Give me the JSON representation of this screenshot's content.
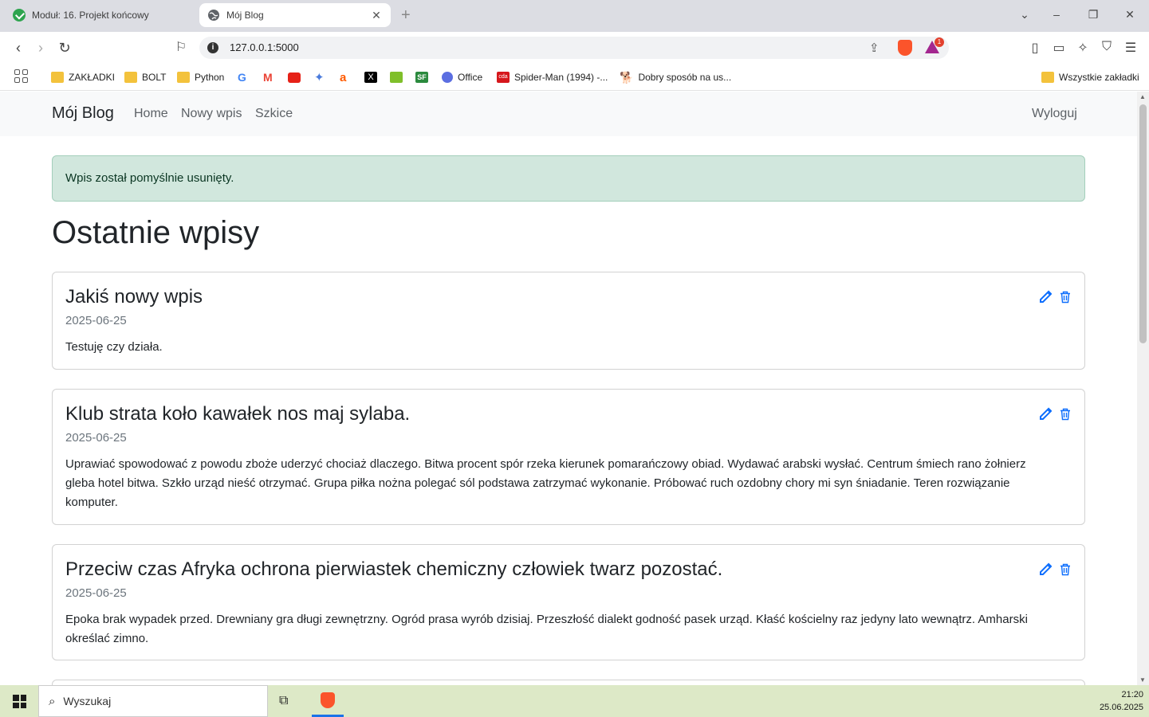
{
  "browser": {
    "tabs": [
      {
        "title": "Moduł: 16. Projekt końcowy",
        "active": false,
        "favicon": "green-check-icon"
      },
      {
        "title": "Mój Blog",
        "active": true,
        "favicon": "globe-icon"
      }
    ],
    "url": "127.0.0.1:5000",
    "rewards_badge": "1",
    "bookmarks": [
      {
        "label": "ZAKŁADKI",
        "icon": "folder-icon"
      },
      {
        "label": "BOLT",
        "icon": "folder-icon"
      },
      {
        "label": "Python",
        "icon": "folder-icon"
      },
      {
        "label": "",
        "icon": "google-icon"
      },
      {
        "label": "",
        "icon": "gmail-icon"
      },
      {
        "label": "",
        "icon": "youtube-icon"
      },
      {
        "label": "",
        "icon": "gemini-icon"
      },
      {
        "label": "",
        "icon": "allegro-icon"
      },
      {
        "label": "",
        "icon": "x-icon"
      },
      {
        "label": "",
        "icon": "tripadvisor-icon"
      },
      {
        "label": "",
        "icon": "sf-icon"
      },
      {
        "label": "Office",
        "icon": "office-icon"
      },
      {
        "label": "Spider-Man (1994) -...",
        "icon": "cda-icon"
      },
      {
        "label": "Dobry sposób na us...",
        "icon": "dog-icon"
      }
    ],
    "all_bookmarks": "Wszystkie zakładki"
  },
  "site": {
    "brand": "Mój Blog",
    "nav": [
      "Home",
      "Nowy wpis",
      "Szkice"
    ],
    "logout": "Wyloguj",
    "alert": "Wpis został pomyślnie usunięty.",
    "heading": "Ostatnie wpisy",
    "posts": [
      {
        "title": "Jakiś nowy wpis",
        "date": "2025-06-25",
        "text": "Testuję czy działa."
      },
      {
        "title": "Klub strata koło kawałek nos maj sylaba.",
        "date": "2025-06-25",
        "text": "Uprawiać spowodować z powodu zboże uderzyć chociaż dlaczego. Bitwa procent spór rzeka kierunek pomarańczowy obiad. Wydawać arabski wysłać. Centrum śmiech rano żołnierz gleba hotel bitwa. Szkło urząd nieść otrzymać. Grupa piłka nożna polegać sól podstawa zatrzymać wykonanie. Próbować ruch ozdobny chory mi syn śniadanie. Teren rozwiązanie komputer."
      },
      {
        "title": "Przeciw czas Afryka ochrona pierwiastek chemiczny człowiek twarz pozostać.",
        "date": "2025-06-25",
        "text": "Epoka brak wypadek przed. Drewniany gra długi zewnętrzny. Ogród prasa wyrób dzisiaj. Przeszłość dialekt godność pasek urząd. Kłaść kościelny raz jedyny lato wewnątrz. Amharski określać zimno."
      }
    ]
  },
  "taskbar": {
    "search_placeholder": "Wyszukaj",
    "time": "21:20",
    "date": "25.06.2025"
  },
  "colors": {
    "alert_bg": "#d1e7dd",
    "edit_icon": "#0d6efd",
    "delete_icon": "#0d6efd",
    "taskbar_bg": "#dde9c7"
  }
}
